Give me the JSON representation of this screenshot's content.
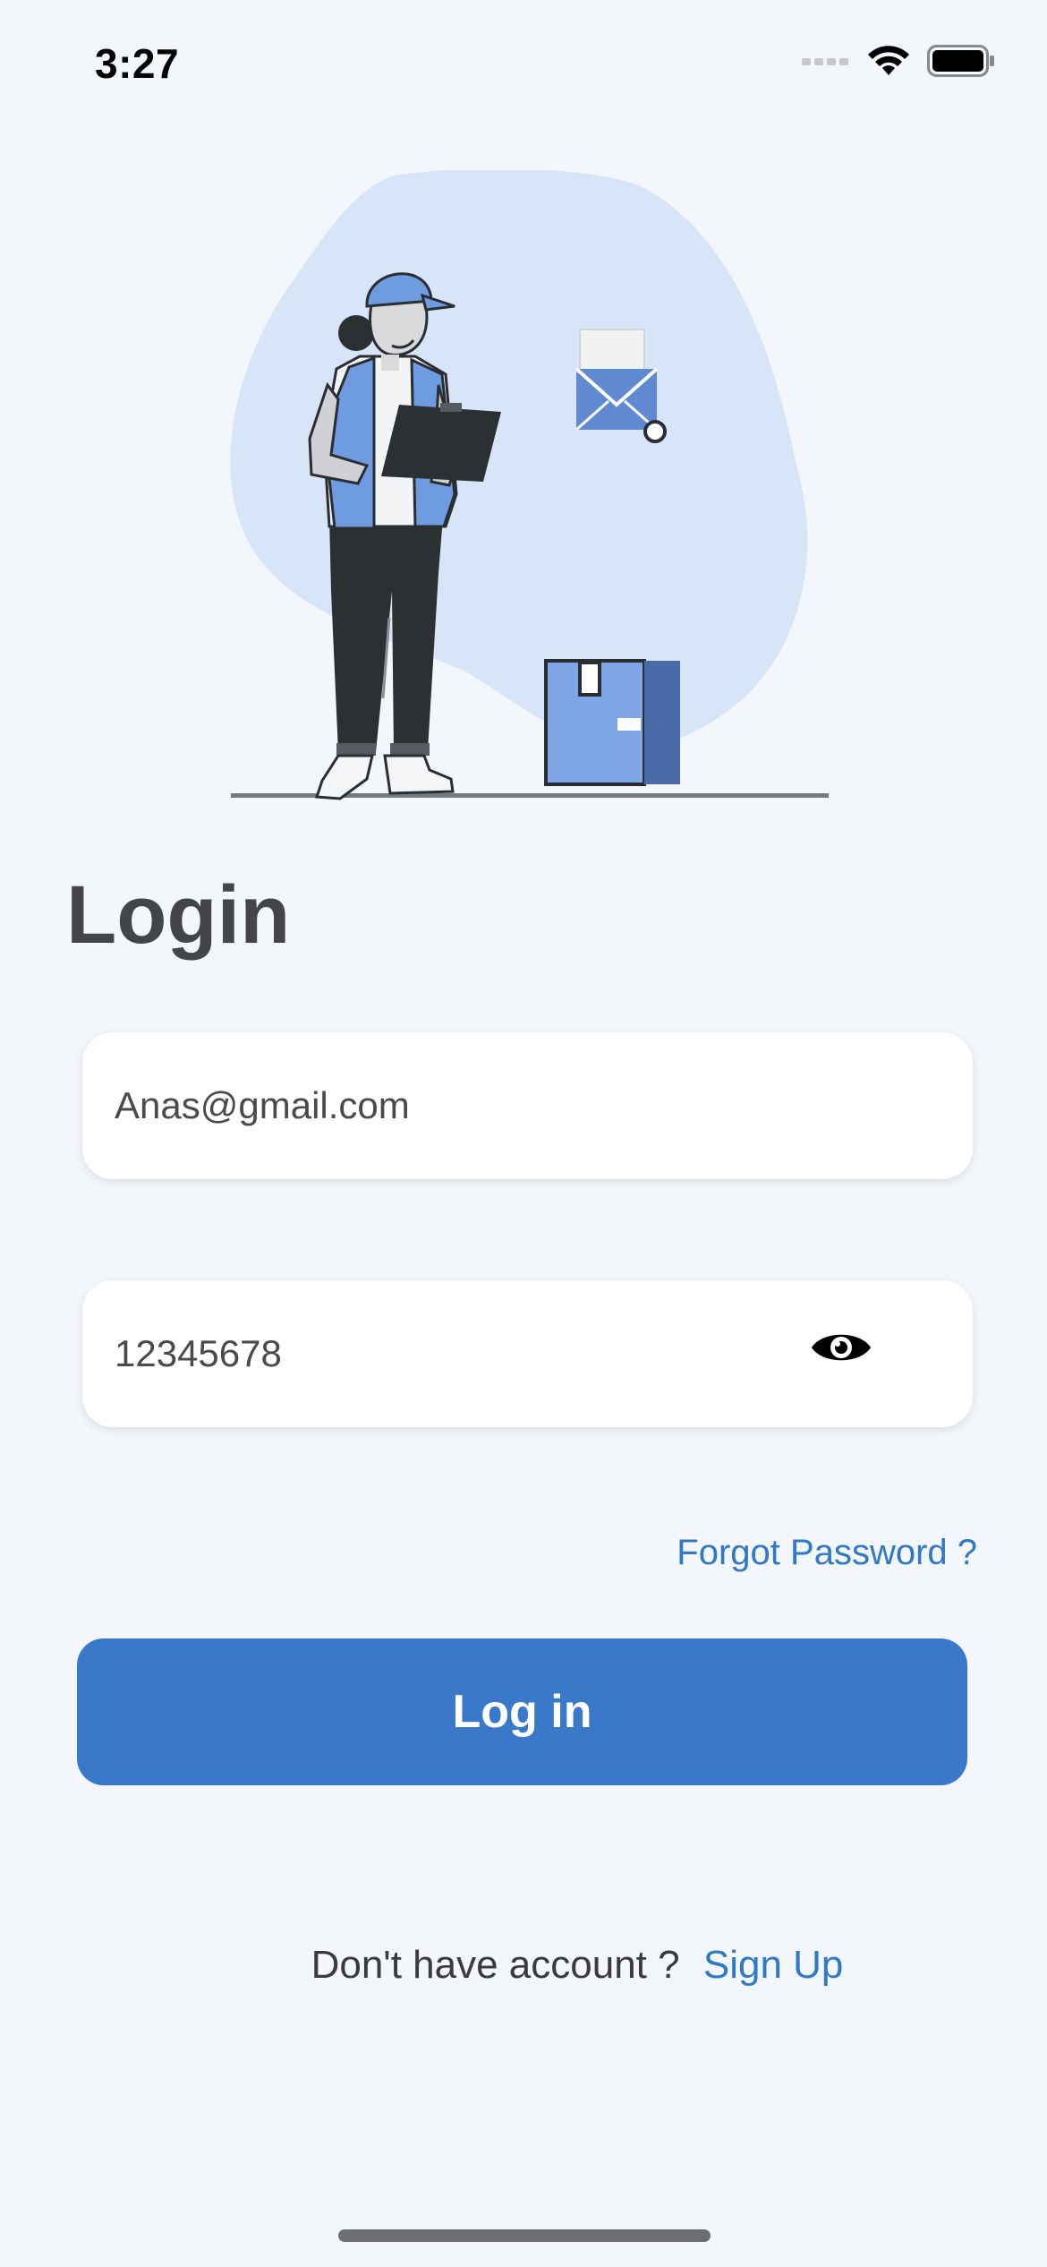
{
  "status_bar": {
    "time": "3:27",
    "icons": [
      "signal-icon",
      "wifi-icon",
      "battery-icon"
    ]
  },
  "hero": {
    "illustration": "delivery-person-with-clipboard-illustration"
  },
  "login": {
    "title": "Login",
    "email_value": "Anas@gmail.com",
    "password_value": "12345678",
    "password_toggle_icon": "eye-icon",
    "forgot_password": "Forgot Password ?",
    "submit_label": "Log in",
    "signup_prompt": "Don't have account ?",
    "signup_link": "Sign Up"
  },
  "colors": {
    "background": "#f3f6fb",
    "primary": "#3a78c9",
    "link": "#2f79c6",
    "title": "#444548"
  }
}
